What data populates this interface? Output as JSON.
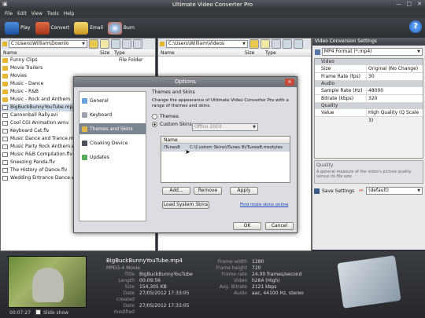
{
  "app": {
    "title": "Ultimate Video Converter Pro"
  },
  "menu": [
    "File",
    "Edit",
    "View",
    "Tools",
    "Help"
  ],
  "toolbar": {
    "play": "Play",
    "convert": "Convert",
    "email": "Email",
    "burn": "Burn"
  },
  "left_panel": {
    "path": "C:\\Users\\William\\Downlo",
    "col_name": "Name",
    "col_size": "Size",
    "col_type": "Type",
    "files": [
      {
        "name": "Funny Clips",
        "type": "File Folder",
        "kind": "folder"
      },
      {
        "name": "Movie Trailers",
        "type": "",
        "kind": "folder"
      },
      {
        "name": "Movies",
        "type": "",
        "kind": "folder"
      },
      {
        "name": "Music - Dance",
        "type": "",
        "kind": "folder"
      },
      {
        "name": "Music - R&B",
        "type": "",
        "kind": "folder"
      },
      {
        "name": "Music - Rock and Anthem",
        "type": "",
        "kind": "folder"
      },
      {
        "name": "BigBuckBunnyYouTube.mp4",
        "type": "",
        "kind": "video"
      },
      {
        "name": "Cannonball Rally.avi",
        "type": "",
        "kind": "video"
      },
      {
        "name": "Cool CGI Animation.wmv",
        "type": "",
        "kind": "video"
      },
      {
        "name": "Keyboard Cat.flv",
        "type": "",
        "kind": "video"
      },
      {
        "name": "Music Dance and Trance.mp",
        "type": "",
        "kind": "video"
      },
      {
        "name": "Music Party Rock Anthem.wi",
        "type": "",
        "kind": "video"
      },
      {
        "name": "Music R&B Compilation.flv",
        "type": "",
        "kind": "video"
      },
      {
        "name": "Sneezing Panda.flv",
        "type": "",
        "kind": "video"
      },
      {
        "name": "The History of Dance.flv",
        "type": "",
        "kind": "video"
      },
      {
        "name": "Wedding Entrance Dance.we",
        "type": "",
        "kind": "video"
      }
    ]
  },
  "right_panel": {
    "path": "C:\\Users\\William\\Videos",
    "col_name": "Name",
    "col_size": "Size",
    "col_type": "Type"
  },
  "settings": {
    "header": "Video Conversion Settings",
    "format": "MP4 Format (*.mp4)",
    "groups": [
      {
        "name": "Video",
        "rows": [
          {
            "k": "Size",
            "v": "Original (No Change)"
          },
          {
            "k": "Frame Rate (fps)",
            "v": "30"
          }
        ]
      },
      {
        "name": "Audio",
        "rows": [
          {
            "k": "Sample Rate (Hz)",
            "v": "48000"
          },
          {
            "k": "Bitrate (kbps)",
            "v": "320"
          }
        ]
      },
      {
        "name": "Quality",
        "rows": [
          {
            "k": "Value",
            "v": "High Quality (Q Scale 3)"
          }
        ]
      }
    ],
    "desc_title": "Quality",
    "desc": "A general measure of the video's picture quality versus its file size.",
    "save_label": "Save Settings",
    "preset": "(default)"
  },
  "dialog": {
    "title": "Options",
    "nav": [
      "General",
      "Keyboard",
      "Themes and Skins",
      "Cloaking Device",
      "Updates"
    ],
    "section": "Themes and Skins",
    "description": "Change the appearance of Ultimate Video Converter Pro with a range of themes and skins.",
    "themes_label": "Themes",
    "themes_value": "Office 2003",
    "custom_label": "Custom Skins",
    "list_header": "Name",
    "skin_name": "iTunes8",
    "skin_path": "C:\\Custom Skins\\iTunes 8\\iTunes8.msstyles",
    "add": "Add...",
    "remove": "Remove",
    "apply": "Apply",
    "load": "Load System Skins",
    "find_more": "Find more skins online",
    "ok": "OK",
    "cancel": "Cancel"
  },
  "preview": {
    "time": "00:07:27",
    "slideshow": "Slide show"
  },
  "fileinfo": {
    "filename": "BigBuckBunnyYouTube.mp4",
    "format": "MPEG-4 Movie",
    "left": [
      {
        "k": "Title",
        "v": "BigBuckBunnyYouTube"
      },
      {
        "k": "Length",
        "v": "00:09:56"
      },
      {
        "k": "Size",
        "v": "154,305 KB"
      },
      {
        "k": "Date created",
        "v": "27/05/2012 17:33:05"
      },
      {
        "k": "Date modified",
        "v": "27/05/2012 17:33:05"
      }
    ],
    "right": [
      {
        "k": "Frame width",
        "v": "1280"
      },
      {
        "k": "Frame height",
        "v": "720"
      },
      {
        "k": "Frame rate",
        "v": "24.00 frames/second"
      },
      {
        "k": "Video",
        "v": "h264 (High)"
      },
      {
        "k": "Avg. Bitrate",
        "v": "2121 kbps"
      },
      {
        "k": "Audio",
        "v": "aac, 44100 Hz, stereo"
      }
    ]
  }
}
